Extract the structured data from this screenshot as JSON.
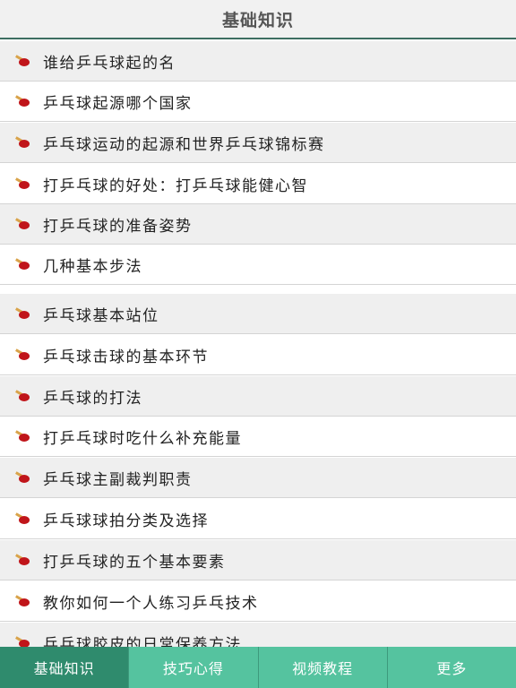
{
  "header": {
    "title": "基础知识"
  },
  "list": {
    "items": [
      {
        "label": "谁给乒乓球起的名"
      },
      {
        "label": "乒乓球起源哪个国家"
      },
      {
        "label": "乒乓球运动的起源和世界乒乓球锦标赛"
      },
      {
        "label": "打乒乓球的好处：打乒乓球能健心智"
      },
      {
        "label": "打乒乓球的准备姿势"
      },
      {
        "label": "几种基本步法"
      },
      {
        "label": "乒乓球基本站位"
      },
      {
        "label": "乒乓球击球的基本环节"
      },
      {
        "label": "乒乓球的打法"
      },
      {
        "label": "打乒乓球时吃什么补充能量"
      },
      {
        "label": "乒乓球主副裁判职责"
      },
      {
        "label": "乒乓球球拍分类及选择"
      },
      {
        "label": "打乒乓球的五个基本要素"
      },
      {
        "label": "教你如何一个人练习乒乓技术"
      },
      {
        "label": "乒乓球胶皮的日常保养方法"
      }
    ],
    "icon": "ping-pong-paddle-icon"
  },
  "tabbar": {
    "tabs": [
      {
        "label": "基础知识",
        "active": true
      },
      {
        "label": "技巧心得"
      },
      {
        "label": "视频教程"
      },
      {
        "label": "更多"
      }
    ]
  },
  "colors": {
    "header_bg": "#f1f1f1",
    "header_border": "#3e6e62",
    "row_alt_bg": "#efefef",
    "tabbar_bg": "#55c39f",
    "tab_active_bg": "#2f8b6d",
    "paddle_red": "#c0151a",
    "paddle_handle": "#d9a34a"
  }
}
